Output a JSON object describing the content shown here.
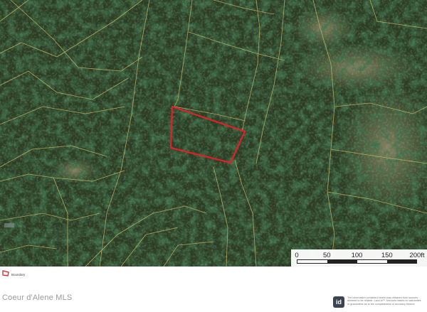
{
  "map": {
    "type": "aerial-parcel-map",
    "highlight_color": "#e0212b",
    "parcel_line_color": "#c7b76a",
    "scale": {
      "unit": "ft",
      "ticks": [
        "0",
        "50",
        "100",
        "150",
        "200ft"
      ]
    }
  },
  "legend": {
    "items": [
      {
        "icon": "boundary-polygon-icon",
        "label": "Boundary",
        "color": "#e0212b"
      }
    ]
  },
  "footer": {
    "title": "Coeur d'Alene MLS",
    "logo_text": "id",
    "disclaimer": "The information contained herein was obtained from sources deemed to be reliable. Land id™ Services makes no warranties or guarantees as to the completeness or accuracy thereof."
  }
}
